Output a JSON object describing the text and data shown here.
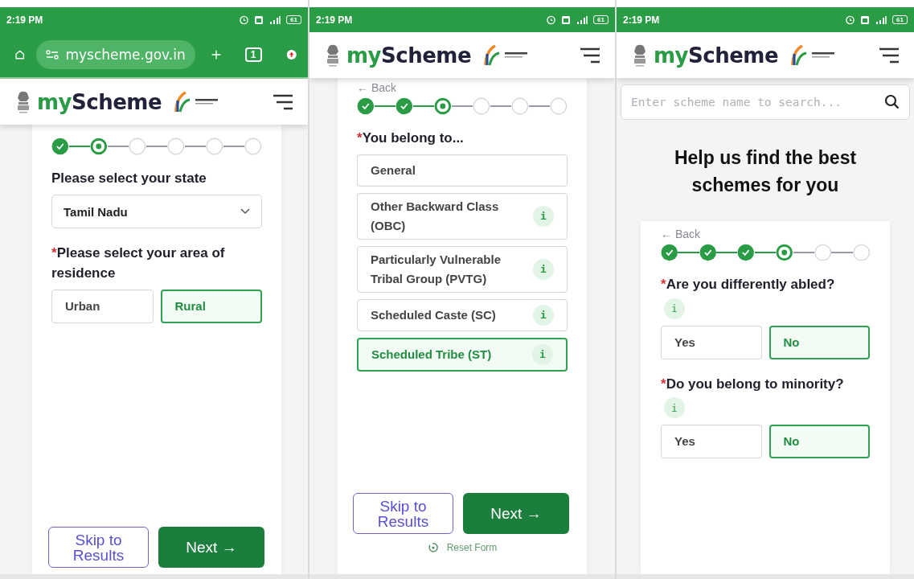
{
  "panels": [
    {
      "status_bar": {
        "time": "2:19 PM",
        "battery": "61"
      },
      "browser_bar": {
        "url": "myscheme.gov.in",
        "tab_count": "1"
      },
      "header": {
        "logo_prefix": "my",
        "logo_suffix": "Scheme"
      },
      "form": {
        "steps": [
          {
            "kind": "done"
          },
          {
            "kind": "current"
          },
          {
            "kind": "pending"
          },
          {
            "kind": "pending"
          },
          {
            "kind": "pending"
          },
          {
            "kind": "pending"
          }
        ],
        "questions": [
          {
            "kind": "dropdown",
            "label": "Please select your state",
            "value": "Tamil Nadu"
          },
          {
            "kind": "tiles",
            "required_mark": "*",
            "label": "Please select your area of residence",
            "options": [
              {
                "label": "Urban",
                "selected": false
              },
              {
                "label": "Rural",
                "selected": true
              }
            ]
          }
        ],
        "skip_button": "Skip to Results",
        "next_button": "Next →"
      }
    },
    {
      "status_bar": {
        "time": "2:19 PM",
        "battery": "61"
      },
      "header": {
        "logo_prefix": "my",
        "logo_suffix": "Scheme"
      },
      "form": {
        "back": "← Back",
        "steps": [
          {
            "kind": "done"
          },
          {
            "kind": "done"
          },
          {
            "kind": "current"
          },
          {
            "kind": "pending"
          },
          {
            "kind": "pending"
          },
          {
            "kind": "pending"
          }
        ],
        "questions": [
          {
            "kind": "list",
            "required_mark": "*",
            "label": "You belong to...",
            "options": [
              {
                "label": "General",
                "selected": false
              },
              {
                "label": "Other Backward Class (OBC)",
                "info": "i",
                "selected": false
              },
              {
                "label": "Particularly Vulnerable Tribal Group (PVTG)",
                "info": "i",
                "selected": false
              },
              {
                "label": "Scheduled Caste (SC)",
                "info": "i",
                "selected": false
              },
              {
                "label": "Scheduled Tribe (ST)",
                "info": "i",
                "selected": true
              }
            ]
          }
        ],
        "skip_button": "Skip to Results",
        "next_button": "Next →",
        "reset": "Reset Form"
      }
    },
    {
      "status_bar": {
        "time": "2:19 PM",
        "battery": "61"
      },
      "header": {
        "logo_prefix": "my",
        "logo_suffix": "Scheme"
      },
      "search": {
        "placeholder": "Enter scheme name to search..."
      },
      "heading": "Help us find the best schemes for you",
      "form": {
        "back": "← Back",
        "steps": [
          {
            "kind": "done"
          },
          {
            "kind": "done"
          },
          {
            "kind": "done"
          },
          {
            "kind": "current"
          },
          {
            "kind": "pending"
          },
          {
            "kind": "pending"
          }
        ],
        "questions": [
          {
            "kind": "tiles",
            "required_mark": "*",
            "label": "Are you differently abled?",
            "info": "i",
            "options": [
              {
                "label": "Yes",
                "selected": false
              },
              {
                "label": "No",
                "selected": true
              }
            ]
          },
          {
            "kind": "tiles",
            "required_mark": "*",
            "label": "Do you belong to minority?",
            "info": "i",
            "options": [
              {
                "label": "Yes",
                "selected": false
              },
              {
                "label": "No",
                "selected": true
              }
            ]
          }
        ]
      }
    }
  ]
}
